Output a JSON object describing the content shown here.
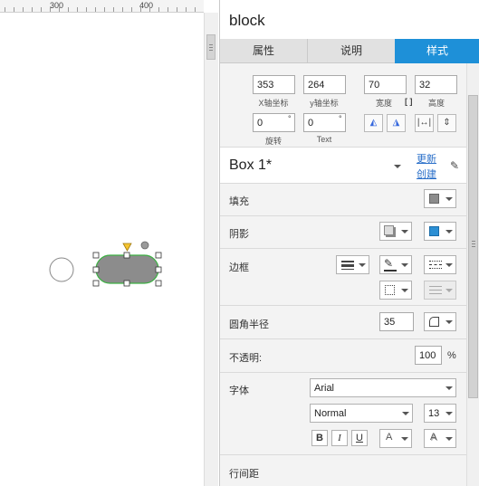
{
  "ruler": {
    "labels": [
      "300",
      "400"
    ]
  },
  "panel": {
    "title": "block",
    "tabs": [
      {
        "label": "属性",
        "active": false
      },
      {
        "label": "说明",
        "active": false
      },
      {
        "label": "样式",
        "active": true
      }
    ],
    "geometry": {
      "x": {
        "value": "353",
        "caption": "X轴坐标"
      },
      "y": {
        "value": "264",
        "caption": "y轴坐标"
      },
      "width": {
        "value": "70",
        "caption": "宽度"
      },
      "height": {
        "value": "32",
        "caption": "高度"
      },
      "rotation": {
        "value": "0",
        "unit": "°",
        "caption": "旋转"
      },
      "text_rotation": {
        "value": "0",
        "unit": "°",
        "caption": "Text"
      }
    },
    "style": {
      "name": "Box 1*",
      "update_link": "更新",
      "create_link": "创建"
    },
    "fill": {
      "label": "填充",
      "color": "#8c8c8c"
    },
    "shadow": {
      "label": "阴影",
      "color": "#2b8fd4"
    },
    "border": {
      "label": "边框"
    },
    "corner_radius": {
      "label": "圆角半径",
      "value": "35"
    },
    "opacity": {
      "label": "不透明:",
      "value": "100",
      "unit": "%"
    },
    "font": {
      "label": "字体",
      "family": "Arial",
      "weight": "Normal",
      "size": "13",
      "bold": "B",
      "italic": "I",
      "underline": "U",
      "text_color_glyph": "A",
      "text_shadow_glyph": "A"
    },
    "line_spacing": {
      "label": "行间距"
    }
  },
  "colors": {
    "accent": "#1e90d8",
    "shape_fill": "#8c8c8c",
    "shape_border": "#3cb043"
  }
}
